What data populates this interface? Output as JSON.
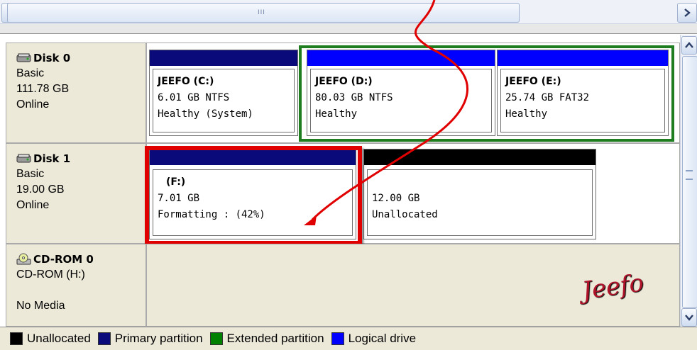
{
  "scrollbar": {
    "grip_label": "III"
  },
  "disks": [
    {
      "name": "Disk 0",
      "type": "Basic",
      "size": "111.78 GB",
      "status": "Online"
    },
    {
      "name": "Disk 1",
      "type": "Basic",
      "size": "19.00 GB",
      "status": "Online"
    },
    {
      "name": "CD-ROM 0",
      "type": "CD-ROM (H:)",
      "size": "",
      "status": "No Media"
    }
  ],
  "partitions": {
    "c": {
      "volume": "JEEFO  (C:)",
      "size": "6.01 GB NTFS",
      "status": "Healthy (System)",
      "bar_color": "#0a0a7a"
    },
    "d": {
      "volume": "JEEFO  (D:)",
      "size": "80.03 GB NTFS",
      "status": "Healthy",
      "bar_color": "#0000ff"
    },
    "e": {
      "volume": "JEEFO  (E:)",
      "size": "25.74 GB FAT32",
      "status": "Healthy",
      "bar_color": "#0000ff"
    },
    "f": {
      "volume": "(F:)",
      "size": "7.01 GB",
      "status": "Formatting : (42%)",
      "bar_color": "#0a0a7a",
      "progress_percent": 42
    },
    "unalloc": {
      "volume": "",
      "size": "12.00 GB",
      "status": "Unallocated",
      "bar_color": "#000000"
    }
  },
  "legend": [
    {
      "label": "Unallocated",
      "color": "#000000"
    },
    {
      "label": "Primary partition",
      "color": "#0a0a7a"
    },
    {
      "label": "Extended partition",
      "color": "#008000"
    },
    {
      "label": "Logical drive",
      "color": "#0000ff"
    }
  ],
  "highlight_colors": {
    "extended_frame": "#1e7d1e",
    "callout_frame": "#e00000",
    "arrow": "#e00000"
  },
  "watermark": "Jeefo"
}
